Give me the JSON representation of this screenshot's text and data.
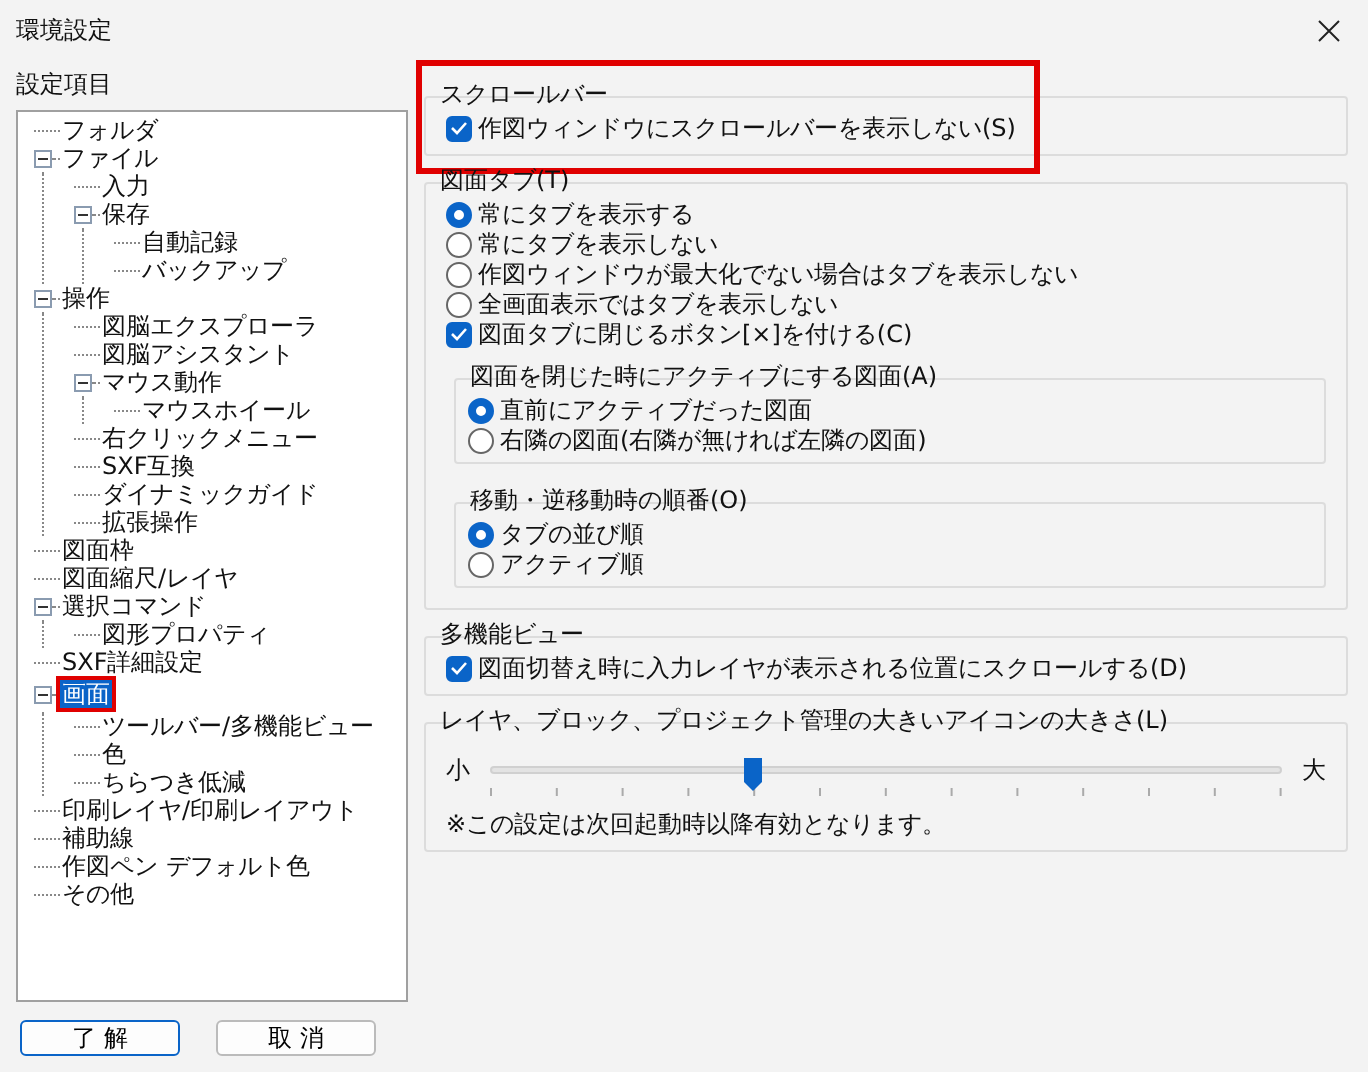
{
  "window": {
    "title": "環境設定"
  },
  "sidebar": {
    "label": "設定項目",
    "tree": [
      {
        "label": "フォルダ",
        "selected": false,
        "highlighted": false
      },
      {
        "label": "ファイル",
        "selected": false,
        "highlighted": false,
        "expanded": true,
        "children": [
          {
            "label": "入力",
            "selected": false,
            "highlighted": false
          },
          {
            "label": "保存",
            "selected": false,
            "highlighted": false,
            "expanded": true,
            "children": [
              {
                "label": "自動記録",
                "selected": false,
                "highlighted": false
              },
              {
                "label": "バックアップ",
                "selected": false,
                "highlighted": false
              }
            ]
          }
        ]
      },
      {
        "label": "操作",
        "selected": false,
        "highlighted": false,
        "expanded": true,
        "children": [
          {
            "label": "図脳エクスプローラ",
            "selected": false,
            "highlighted": false
          },
          {
            "label": "図脳アシスタント",
            "selected": false,
            "highlighted": false
          },
          {
            "label": "マウス動作",
            "selected": false,
            "highlighted": false,
            "expanded": true,
            "children": [
              {
                "label": "マウスホイール",
                "selected": false,
                "highlighted": false
              }
            ]
          },
          {
            "label": "右クリックメニュー",
            "selected": false,
            "highlighted": false
          },
          {
            "label": "SXF互換",
            "selected": false,
            "highlighted": false
          },
          {
            "label": "ダイナミックガイド",
            "selected": false,
            "highlighted": false
          },
          {
            "label": "拡張操作",
            "selected": false,
            "highlighted": false
          }
        ]
      },
      {
        "label": "図面枠",
        "selected": false,
        "highlighted": false
      },
      {
        "label": "図面縮尺/レイヤ",
        "selected": false,
        "highlighted": false
      },
      {
        "label": "選択コマンド",
        "selected": false,
        "highlighted": false,
        "expanded": true,
        "children": [
          {
            "label": "図形プロパティ",
            "selected": false,
            "highlighted": false
          }
        ]
      },
      {
        "label": "SXF詳細設定",
        "selected": false,
        "highlighted": false
      },
      {
        "label": "画面",
        "selected": true,
        "highlighted": true,
        "expanded": true,
        "children": [
          {
            "label": "ツールバー/多機能ビュー",
            "selected": false,
            "highlighted": false
          },
          {
            "label": "色",
            "selected": false,
            "highlighted": false
          },
          {
            "label": "ちらつき低減",
            "selected": false,
            "highlighted": false
          }
        ]
      },
      {
        "label": "印刷レイヤ/印刷レイアウト",
        "selected": false,
        "highlighted": false
      },
      {
        "label": "補助線",
        "selected": false,
        "highlighted": false
      },
      {
        "label": "作図ペン デフォルト色",
        "selected": false,
        "highlighted": false
      },
      {
        "label": "その他",
        "selected": false,
        "highlighted": false
      }
    ]
  },
  "buttons": [
    {
      "label": "了 解",
      "default": true
    },
    {
      "label": "取 消",
      "default": false
    }
  ],
  "sections": [
    {
      "title": "スクロールバー",
      "highlighted": true,
      "items": [
        {
          "kind": "checkbox",
          "label": "作図ウィンドウにスクロールバーを表示しない(S)",
          "checked": true
        }
      ]
    },
    {
      "title": "図面タブ(T)",
      "highlighted": false,
      "items": [
        {
          "kind": "radio",
          "label": "常にタブを表示する",
          "selected": true
        },
        {
          "kind": "radio",
          "label": "常にタブを表示しない",
          "selected": false
        },
        {
          "kind": "radio",
          "label": "作図ウィンドウが最大化でない場合はタブを表示しない",
          "selected": false
        },
        {
          "kind": "radio",
          "label": "全画面表示ではタブを表示しない",
          "selected": false
        },
        {
          "kind": "checkbox",
          "label": "図面タブに閉じるボタン[×]を付ける(C)",
          "checked": true
        },
        {
          "kind": "group",
          "title": "図面を閉じた時にアクティブにする図面(A)",
          "items": [
            {
              "kind": "radio",
              "label": "直前にアクティブだった図面",
              "selected": true
            },
            {
              "kind": "radio",
              "label": "右隣の図面(右隣が無ければ左隣の図面)",
              "selected": false
            }
          ]
        },
        {
          "kind": "group",
          "title": "移動・逆移動時の順番(O)",
          "items": [
            {
              "kind": "radio",
              "label": "タブの並び順",
              "selected": true
            },
            {
              "kind": "radio",
              "label": "アクティブ順",
              "selected": false
            }
          ]
        }
      ]
    },
    {
      "title": "多機能ビュー",
      "highlighted": false,
      "items": [
        {
          "kind": "checkbox",
          "label": "図面切替え時に入力レイヤが表示される位置にスクロールする(D)",
          "checked": true
        }
      ]
    },
    {
      "title": "レイヤ、ブロック、プロジェクト管理の大きいアイコンの大きさ(L)",
      "highlighted": false,
      "items": [
        {
          "kind": "slider",
          "min_label": "小",
          "max_label": "大",
          "level": 0.33
        },
        {
          "kind": "note",
          "text": "※この設定は次回起動時以降有効となります。"
        }
      ]
    }
  ]
}
